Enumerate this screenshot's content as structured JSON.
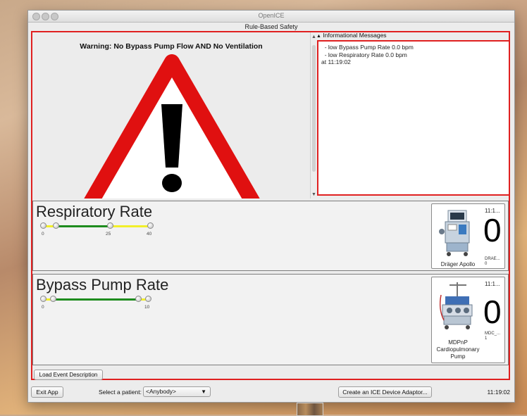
{
  "window": {
    "title": "OpenICE",
    "subtitle": "Rule-Based Safety"
  },
  "warning": {
    "text": "Warning: No Bypass Pump Flow AND No Ventilation",
    "icon": "warning-triangle-icon"
  },
  "info": {
    "label": "Informational Messages",
    "lines": [
      "  - low Bypass Pump Rate 0.0 bpm",
      "  - low Respiratory Rate 0.0 bpm",
      "at 11:19:02"
    ]
  },
  "panels": [
    {
      "title": "Respiratory Rate",
      "ticks": [
        "0",
        "25",
        "40"
      ],
      "device": {
        "time": "11:1...",
        "value": "0",
        "sub1": "DRAE...",
        "sub2": "0",
        "name": "Dräger Apollo"
      }
    },
    {
      "title": "Bypass Pump Rate",
      "ticks": [
        "0",
        "10"
      ],
      "device": {
        "time": "11:1...",
        "value": "0",
        "sub1": "MDC_...",
        "sub2": "1",
        "name": "MDPnP Cardiopulmonary Pump"
      }
    }
  ],
  "buttons": {
    "load_event": "Load Event Description",
    "exit": "Exit App",
    "create_adaptor": "Create an ICE Device Adaptor..."
  },
  "patient": {
    "label": "Select a patient:",
    "selected": "<Anybody>"
  },
  "clock": "11:19:02",
  "colors": {
    "alert_red": "#e02020",
    "slider_green": "#1e8c1e",
    "slider_yellow": "#f2ef2a"
  }
}
